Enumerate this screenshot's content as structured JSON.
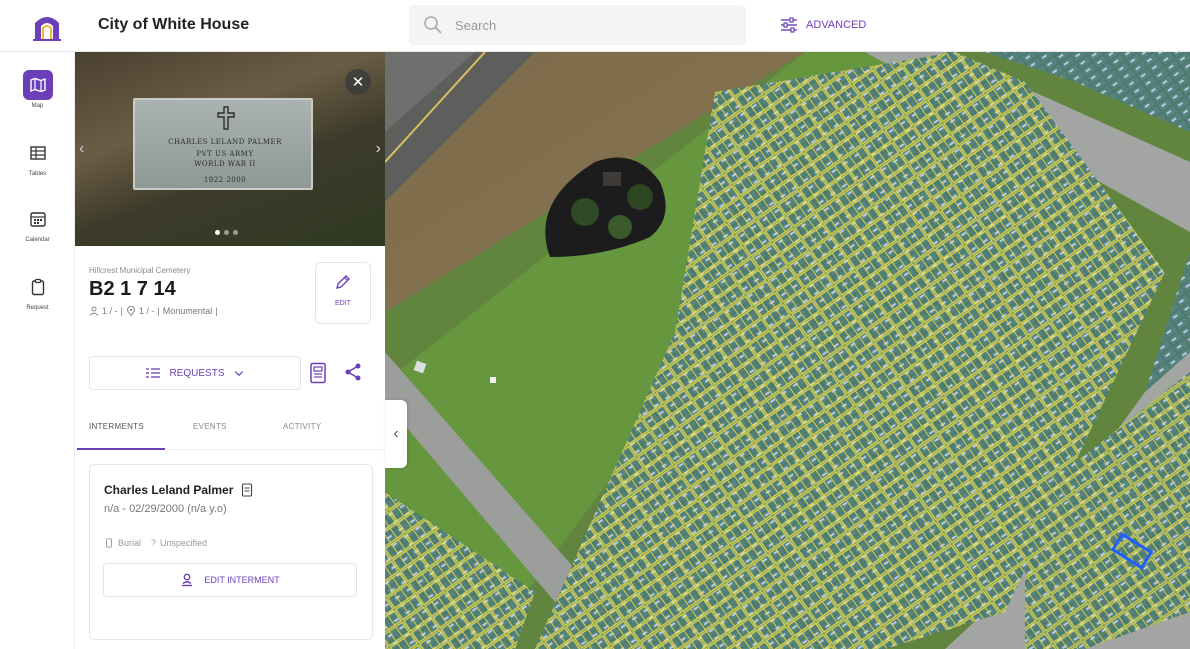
{
  "header": {
    "app_title": "City of White House",
    "search_placeholder": "Search",
    "advanced_label": "ADVANCED",
    "logo_icon": "arch-logo-icon"
  },
  "rail": {
    "items": [
      {
        "label": "Map",
        "icon": "map-icon",
        "active": true
      },
      {
        "label": "Tables",
        "icon": "table-icon",
        "active": false
      },
      {
        "label": "Calendar",
        "icon": "calendar-icon",
        "active": false
      },
      {
        "label": "Request",
        "icon": "clipboard-icon",
        "active": false
      }
    ]
  },
  "photo": {
    "stone_lines": [
      "CHARLES LELAND PALMER",
      "PVT US ARMY",
      "WORLD WAR II",
      "1922          2000"
    ],
    "dots": 3,
    "active_dot": 0
  },
  "plot": {
    "cemetery": "Hillcrest Municipal Cemetery",
    "id": "B2 1 7 14",
    "meta_occupants": "1 / -",
    "meta_burials": "1 / -",
    "meta_type": "Monumental",
    "edit_label": "EDIT"
  },
  "actions": {
    "requests_label": "REQUESTS"
  },
  "tabs": [
    {
      "label": "INTERMENTS",
      "active": true
    },
    {
      "label": "EVENTS",
      "active": false
    },
    {
      "label": "ACTIVITY",
      "active": false
    }
  ],
  "interment": {
    "name": "Charles Leland Palmer",
    "dates": "n/a - 02/29/2000 (n/a y.o)",
    "type": "Burial",
    "status": "Unspecified",
    "edit_label": "EDIT INTERMENT"
  },
  "colors": {
    "accent": "#6b3fb8",
    "plot_outline": "#f0e04a",
    "selected_plot": "#1e5fff"
  }
}
